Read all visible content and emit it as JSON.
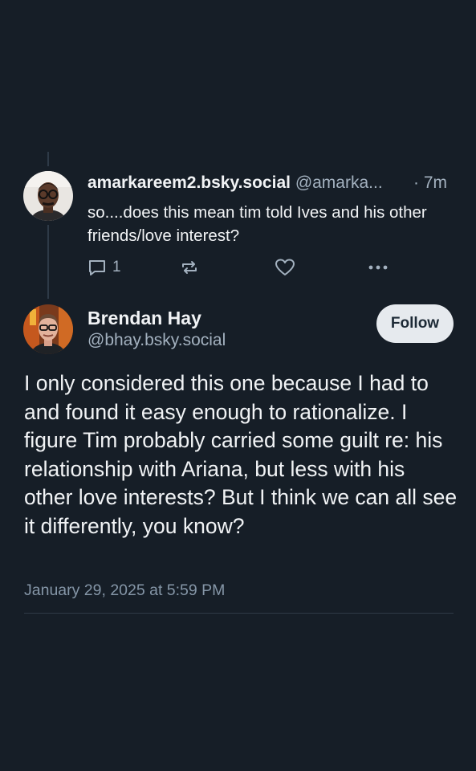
{
  "parent_post": {
    "author_name": "amarkareem2.bsky.social",
    "author_handle": "@amarka...",
    "time": "· 7m",
    "text": "so....does this mean tim told Ives and his other friends/love interest?",
    "reply_count": "1",
    "icons": {
      "reply": "reply-icon",
      "repost": "repost-icon",
      "like": "heart-icon",
      "more": "more-icon"
    }
  },
  "main_post": {
    "author_name": "Brendan Hay",
    "author_handle": "@bhay.bsky.social",
    "follow_label": "Follow",
    "text": "I only considered this one because I had to and found it easy enough to rationalize. I figure Tim probably carried some guilt re: his relationship with Ariana, but less with his other love interests? But I think we can all see it differently, you know?",
    "timestamp": "January 29, 2025 at 5:59 PM"
  },
  "colors": {
    "background": "#161e27",
    "primary_text": "#f1f3f5",
    "secondary_text": "#a3b1bf",
    "follow_button_bg": "#e6eaee",
    "thread_line": "#2e3a47"
  }
}
